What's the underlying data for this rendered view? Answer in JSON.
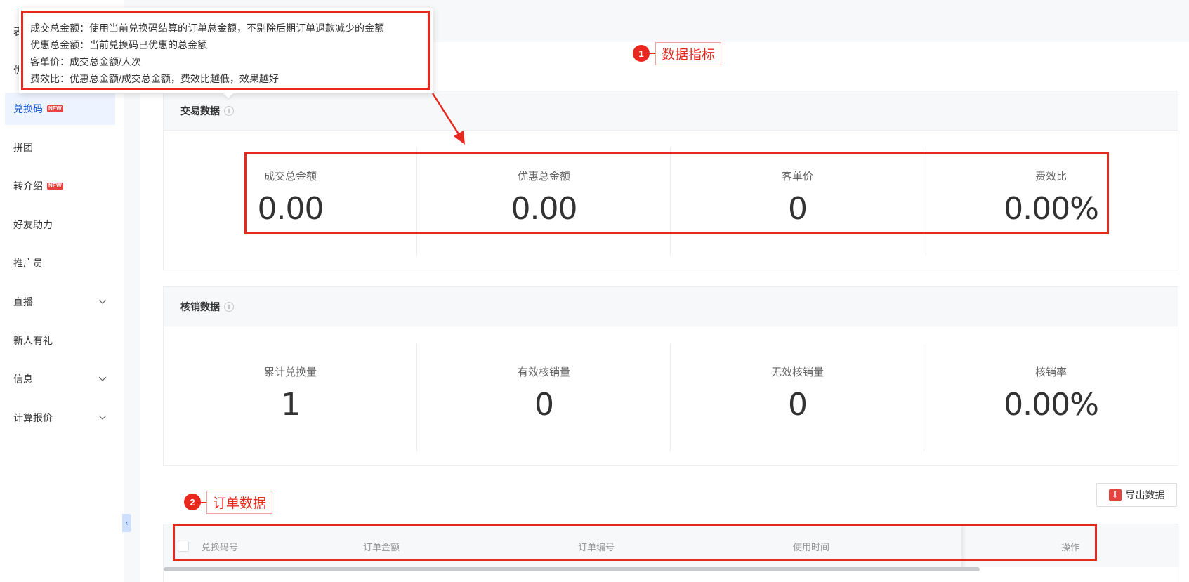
{
  "sidebar": {
    "items": [
      {
        "label": "表",
        "badge": ""
      },
      {
        "label": "优",
        "badge": ""
      },
      {
        "label": "兑换码",
        "badge": "NEW"
      },
      {
        "label": "拼团",
        "badge": ""
      },
      {
        "label": "转介绍",
        "badge": "NEW"
      },
      {
        "label": "好友助力",
        "badge": ""
      },
      {
        "label": "推广员",
        "badge": ""
      },
      {
        "label": "直播",
        "badge": ""
      },
      {
        "label": "新人有礼",
        "badge": ""
      },
      {
        "label": "信息",
        "badge": ""
      },
      {
        "label": "计算报价",
        "badge": ""
      }
    ]
  },
  "tooltip": {
    "lines": [
      "成交总金额：使用当前兑换码结算的订单总金额，不剔除后期订单退款减少的金额",
      "优惠总金额：当前兑换码已优惠的总金额",
      "客单价：成交总金额/人次",
      "费效比：优惠总金额/成交总金额，费效比越低，效果越好"
    ]
  },
  "annotations": {
    "callout1": {
      "number": "1",
      "label": "数据指标"
    },
    "callout2": {
      "number": "2",
      "label": "订单数据"
    }
  },
  "trade": {
    "title": "交易数据",
    "metrics": [
      {
        "label": "成交总金额",
        "value": "0.00"
      },
      {
        "label": "优惠总金额",
        "value": "0.00"
      },
      {
        "label": "客单价",
        "value": "0"
      },
      {
        "label": "费效比",
        "value": "0.00%"
      }
    ]
  },
  "verify": {
    "title": "核销数据",
    "metrics": [
      {
        "label": "累计兑换量",
        "value": "1"
      },
      {
        "label": "有效核销量",
        "value": "0"
      },
      {
        "label": "无效核销量",
        "value": "0"
      },
      {
        "label": "核销率",
        "value": "0.00%"
      }
    ]
  },
  "export": {
    "label": "导出数据",
    "icon": "export-icon"
  },
  "table": {
    "columns": [
      "兑换码号",
      "订单金额",
      "订单编号",
      "使用时间",
      "操作"
    ]
  },
  "colors": {
    "accent": "#155bd4",
    "annotation": "#e8281e",
    "badge": "#e64340"
  }
}
